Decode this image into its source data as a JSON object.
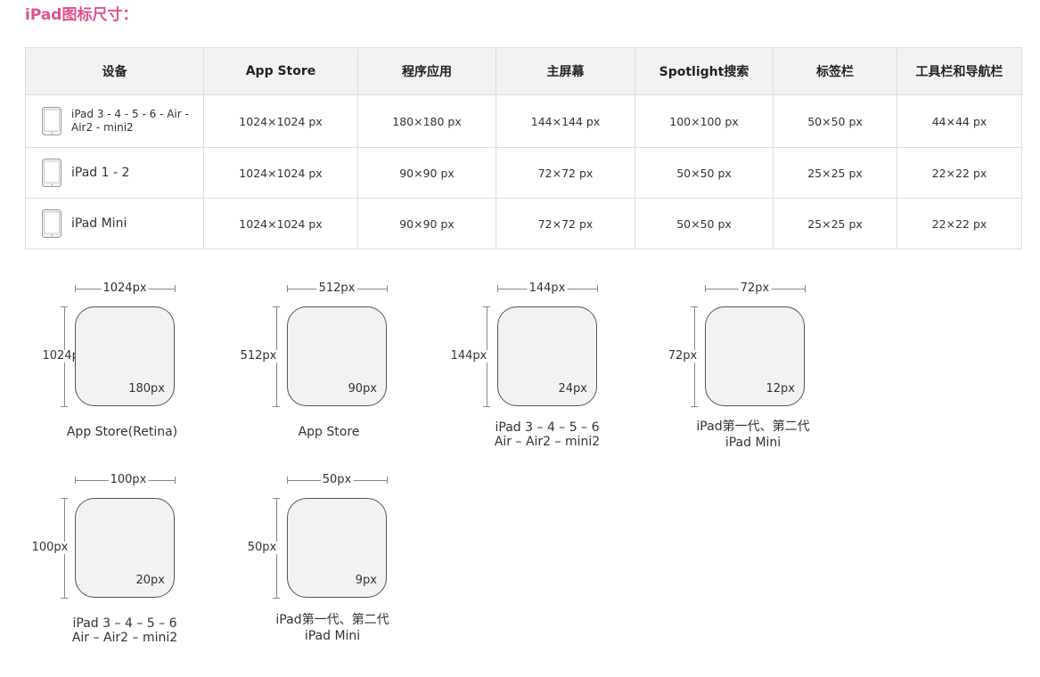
{
  "title": "iPad图标尺寸：",
  "table": {
    "headers": [
      "设备",
      "App Store",
      "程序应用",
      "主屏幕",
      "Spotlight搜索",
      "标签栏",
      "工具栏和导航栏"
    ],
    "rows": [
      {
        "device_line1": "iPad 3 - 4 - 5 - 6 - Air -",
        "device_line2": "Air2 - mini2",
        "cells": [
          "1024×1024 px",
          "180×180 px",
          "144×144 px",
          "100×100 px",
          "50×50 px",
          "44×44 px"
        ]
      },
      {
        "device_line1": "iPad 1 - 2",
        "cells": [
          "1024×1024 px",
          "90×90 px",
          "72×72 px",
          "50×50 px",
          "25×25 px",
          "22×22 px"
        ]
      },
      {
        "device_line1": "iPad Mini",
        "cells": [
          "1024×1024 px",
          "90×90 px",
          "72×72 px",
          "50×50 px",
          "25×25 px",
          "22×22 px"
        ]
      }
    ]
  },
  "icons": [
    {
      "width_label": "1024px",
      "height_label": "1024px",
      "radius_label": "180px",
      "caption_line1": "App Store(Retina)",
      "caption_line2": ""
    },
    {
      "width_label": "512px",
      "height_label": "512px",
      "radius_label": "90px",
      "caption_line1": "App Store",
      "caption_line2": ""
    },
    {
      "width_label": "144px",
      "height_label": "144px",
      "radius_label": "24px",
      "caption_line1": "iPad 3 – 4 – 5 – 6",
      "caption_line2": "Air – Air2 – mini2"
    },
    {
      "width_label": "72px",
      "height_label": "72px",
      "radius_label": "12px",
      "caption_line1": "iPad第一代、第二代",
      "caption_line2": "iPad Mini"
    },
    {
      "width_label": "100px",
      "height_label": "100px",
      "radius_label": "20px",
      "caption_line1": "iPad 3 – 4 – 5 – 6",
      "caption_line2": "Air – Air2 – mini2"
    },
    {
      "width_label": "50px",
      "height_label": "50px",
      "radius_label": "9px",
      "caption_line1": "iPad第一代、第二代",
      "caption_line2": "iPad Mini"
    }
  ]
}
